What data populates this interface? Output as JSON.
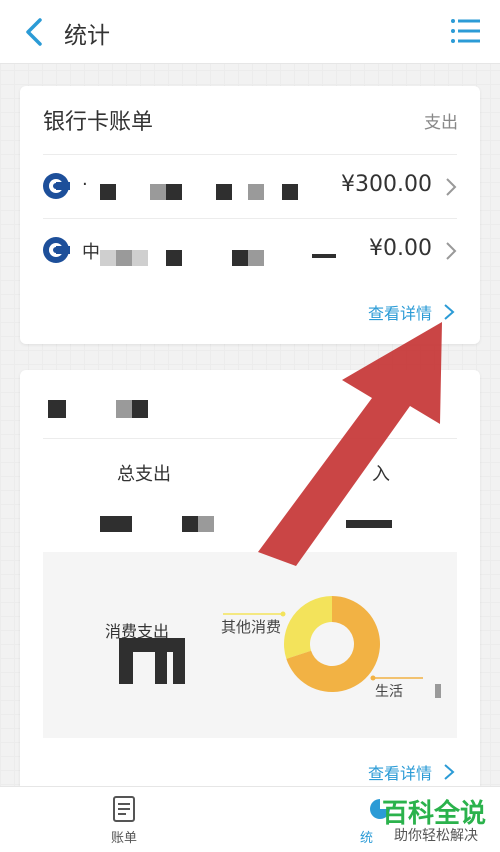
{
  "header": {
    "title": "统计"
  },
  "bank_bill_card": {
    "title": "银行卡账单",
    "right_partial": "支出",
    "rows": [
      {
        "name": "·",
        "amount": "¥300.00"
      },
      {
        "name": "中",
        "amount": "¥0.00"
      }
    ],
    "view_details": "查看详情"
  },
  "stats_card": {
    "total_expense_label": "总支出",
    "income_label_partial": "入",
    "chart": {
      "title": "消费支出",
      "legend_other": "其他消费",
      "legend_life_partial": "生活"
    },
    "view_details": "查看详情"
  },
  "chart_data": {
    "type": "pie",
    "categories": [
      "其他消费",
      "生活"
    ],
    "values": [
      30,
      70
    ],
    "colors": [
      "#f3e35b",
      "#f2b244"
    ]
  },
  "bottom_nav": {
    "items": [
      {
        "label": "账单"
      },
      {
        "label": "统"
      }
    ]
  },
  "watermark": {
    "title": "百科全说",
    "subtitle": "助你轻松解决"
  },
  "colors": {
    "accent": "#2b9bd6",
    "arrow": "#c73b3b",
    "brand_green": "#2bb24c"
  }
}
